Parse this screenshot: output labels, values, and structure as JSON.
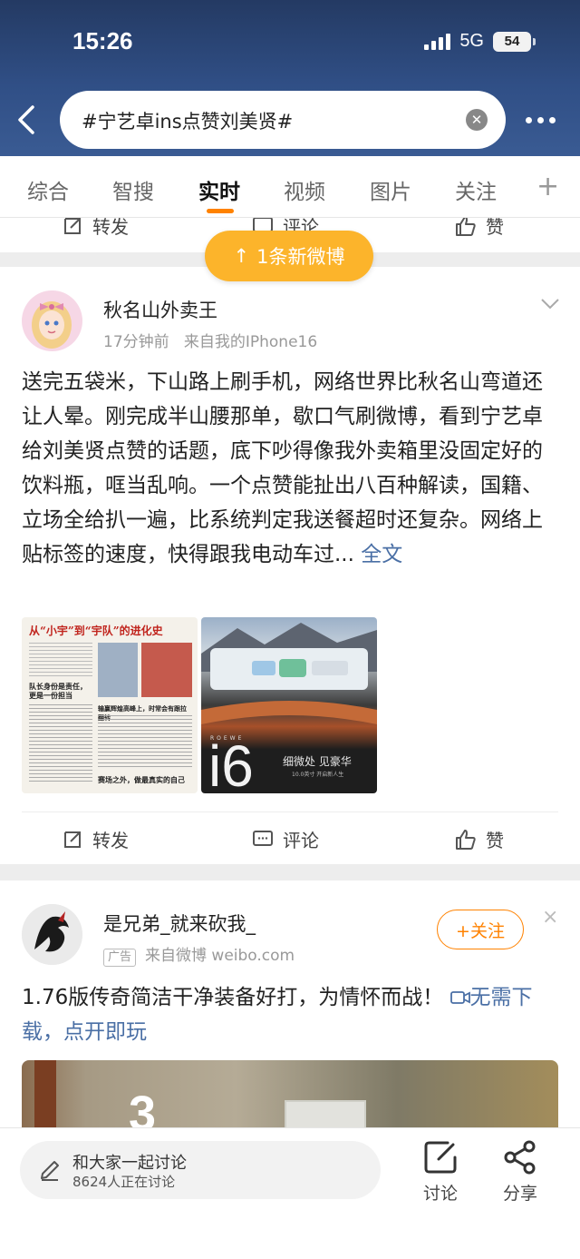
{
  "status_bar": {
    "time": "15:26",
    "network": "5G",
    "battery": "54"
  },
  "search": {
    "query": "#宁艺卓ins点赞刘美贤#"
  },
  "tabs": [
    {
      "label": "综合"
    },
    {
      "label": "智搜"
    },
    {
      "label": "实时"
    },
    {
      "label": "视频"
    },
    {
      "label": "图片"
    },
    {
      "label": "关注"
    }
  ],
  "tab_plus": "+",
  "actions": {
    "repost": "转发",
    "comment": "评论",
    "like": "赞"
  },
  "new_posts_pill": {
    "arrow": "↑",
    "label": "1条新微博"
  },
  "post1": {
    "username": "秋名山外卖王",
    "time": "17分钟前",
    "source": "来自我的IPhone16",
    "text": "送完五袋米，下山路上刷手机，网络世界比秋名山弯道还让人晕。刚完成半山腰那单，歇口气刷微博，看到宁艺卓给刘美贤点赞的话题，底下吵得像我外卖箱里没固定好的饮料瓶，哐当乱响。一个点赞能扯出八百种解读，国籍、立场全给扒一遍，比系统判定我送餐超时还复杂。网络上贴标签的速度，快得跟我电动车过...",
    "full_link": "全文",
    "image1": {
      "headline": "从“小宇”到“宇队”的进化史",
      "sub1": "队长身份是责任，更是一份担当",
      "sub2": "输赢辉煌高峰上，时常会有跟拉翻转",
      "sub3": "赛场之外，做最真实的自己"
    },
    "image2": {
      "brand": "ROEWE",
      "model": "i6",
      "slogan": "细微处 见豪华",
      "tagline": "10.0英寸 开启新人生"
    }
  },
  "post2": {
    "username": "是兄弟_就来砍我_",
    "ad_tag": "广告",
    "source": "来自微博 weibo.com",
    "follow": "+关注",
    "close": "×",
    "text": "1.76版传奇简洁干净装备好打，为情怀而战！",
    "link": "无需下载，点开即玩",
    "image_text": "3"
  },
  "bottom_bar": {
    "discuss_title": "和大家一起讨论",
    "discuss_count": "8624人正在讨论",
    "discuss_btn": "讨论",
    "share_btn": "分享"
  },
  "colors": {
    "accent": "#ff8200",
    "pill": "#fcb42b",
    "link": "#4a6fa5",
    "header": "#304f86"
  }
}
